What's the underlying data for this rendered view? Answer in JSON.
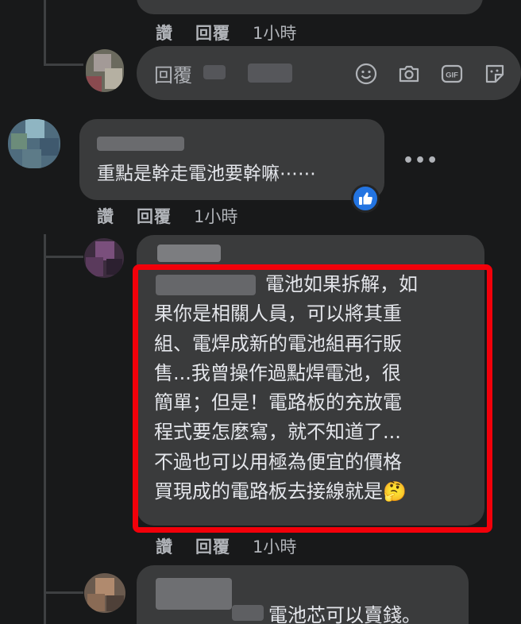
{
  "comment_top": {
    "action_like": "讚",
    "action_reply": "回覆",
    "timestamp": "1小時"
  },
  "reply_box": {
    "placeholder": "回覆",
    "icons": [
      "emoji-icon",
      "camera-icon",
      "gif-icon",
      "sticker-icon"
    ],
    "gif_label": "GIF"
  },
  "comment_1": {
    "text": "重點是幹走電池要幹嘛⋯⋯",
    "more": "•••",
    "reaction": "like",
    "action_like": "讚",
    "action_reply": "回覆",
    "timestamp": "1小時"
  },
  "reply_1": {
    "lines": [
      "電池如果拆解，如",
      "果你是相關人員，可以將其重",
      "組、電焊成新的電池組再行販",
      "售...我曾操作過點焊電池，很",
      "簡單；但是！電路板的充放電",
      "程式要怎麼寫，就不知道了...",
      "不過也可以用極為便宜的價格",
      "買現成的電路板去接線就是🤔"
    ],
    "action_like": "讚",
    "action_reply": "回覆",
    "timestamp": "1小時"
  },
  "reply_2": {
    "text": "電池芯可以賣錢。"
  },
  "colors": {
    "background": "#18191a",
    "bubble": "#3a3b3c",
    "highlight": "#f2000a",
    "like_blue": "#2374e1",
    "muted_text": "#b0b3b8"
  }
}
